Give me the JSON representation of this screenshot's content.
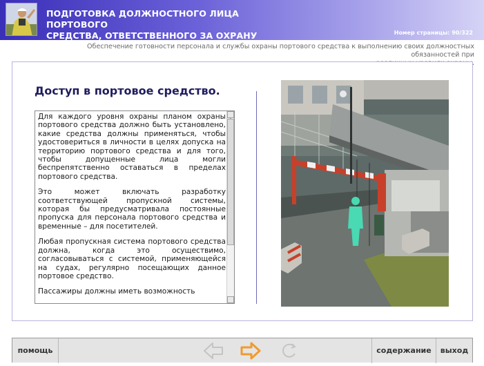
{
  "header": {
    "title_line1": "ПОДГОТОВКА ДОЛЖНОСТНОГО ЛИЦА ПОРТОВОГО",
    "title_line2": "СРЕДСТВА, ОТВЕТСТВЕННОГО ЗА ОХРАНУ",
    "page_number": "Номер страницы: 90/322",
    "logo_icon": "officer-avatar-icon"
  },
  "subtitle_line1": "Обеспечение готовности персонала и службы охраны портового средства к выполнению своих должностных обязанностей при",
  "subtitle_line2": "различных уровнях охраны.",
  "content": {
    "title": "Доступ в портовое средство.",
    "paragraphs": [
      "Для каждого уровня охраны планом охраны портового средства должно быть установлено, какие средства должны применяться, чтобы удостовериться в личности в целях допуска на территорию портового средства и для того, чтобы допущенные лица могли беспрепятственно оставаться в пределах портового средства.",
      "Это может включать разработку соответствующей пропускной системы, которая бы предусматривала постоянные пропуска для персонала портового средства и временные – для посетителей.",
      "Любая пропускная система портового средства должна, когда это осуществимо, согласовываться с системой, применяющейся на судах, регулярно посещающих данное портовое средство.",
      "Пассажиры должны иметь возможность"
    ]
  },
  "footer": {
    "help": "помощь",
    "contents": "содержание",
    "exit": "выход",
    "back_icon": "arrow-left-icon",
    "next_icon": "arrow-right-icon",
    "reload_icon": "reload-icon",
    "colors": {
      "next": "#f29a2e",
      "disabled": "#c4c4c4"
    }
  },
  "colors": {
    "header_dark": "#3a2fb8",
    "title_text": "#1f1d5e",
    "divider": "#6a6ab8"
  }
}
